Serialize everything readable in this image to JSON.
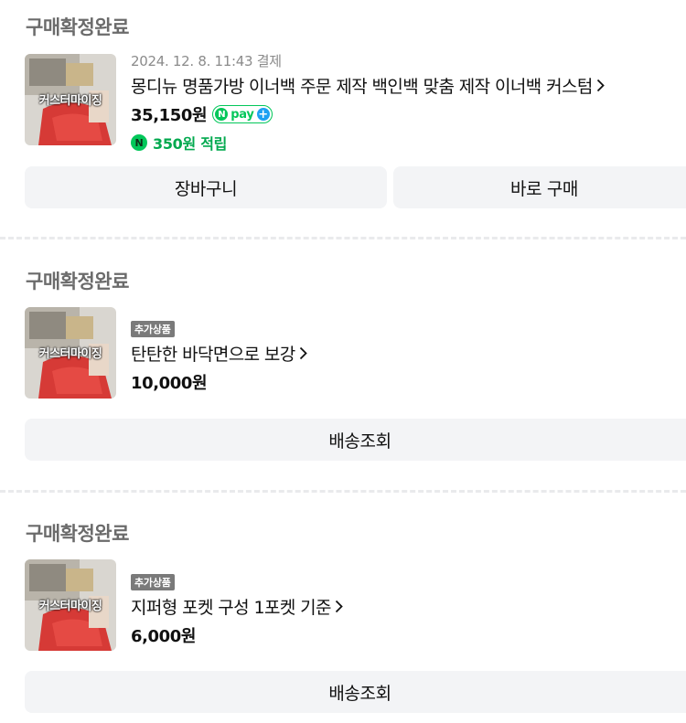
{
  "orders": [
    {
      "status": "구매확정완료",
      "date": "2024. 12. 8. 11:43 결제",
      "thumb_caption": "커스터마이징",
      "product_name": "몽디뉴 명품가방 이너백 주문 제작 백인백 맞춤 제작 이너백 커스텀",
      "price": "35,150원",
      "npay_label": "pay",
      "points": "350원 적립",
      "buttons": [
        "장바구니",
        "바로 구매"
      ]
    },
    {
      "status": "구매확정완료",
      "tag": "추가상품",
      "thumb_caption": "커스터마이징",
      "product_name": "탄탄한 바닥면으로 보강",
      "price": "10,000원",
      "buttons": [
        "배송조회"
      ]
    },
    {
      "status": "구매확정완료",
      "tag": "추가상품",
      "thumb_caption": "커스터마이징",
      "product_name": "지퍼형 포켓 구성 1포켓 기준",
      "price": "6,000원",
      "buttons": [
        "배송조회"
      ]
    }
  ],
  "icons": {
    "chevron": "chevron-right-icon",
    "npay": "npay-badge-icon",
    "points": "naver-points-icon"
  },
  "colors": {
    "accent_green": "#03c75a",
    "points_green": "#03a94f",
    "button_bg": "#f3f4f6",
    "status_gray": "#6b6b6b"
  }
}
